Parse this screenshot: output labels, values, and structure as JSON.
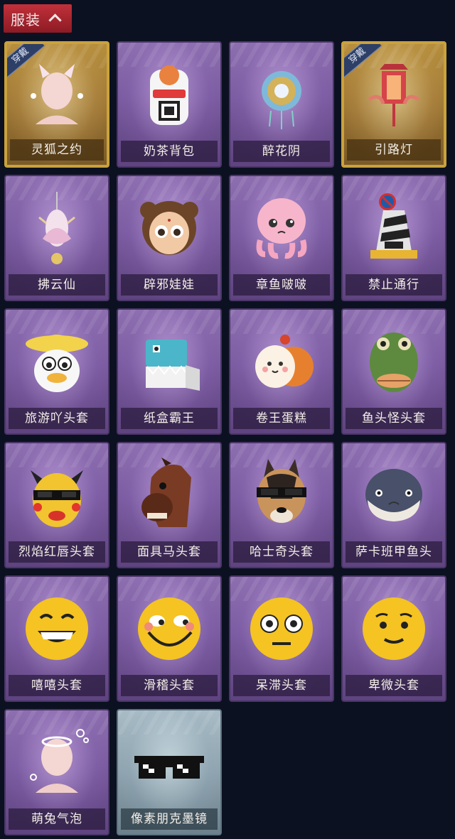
{
  "header": {
    "title": "服装"
  },
  "wear_label": "穿戴",
  "items": [
    {
      "label": "灵狐之约",
      "style": "gold",
      "worn": true,
      "icon": "fox-avatar-icon"
    },
    {
      "label": "奶茶背包",
      "style": "purple",
      "worn": false,
      "icon": "milk-tea-backpack-icon"
    },
    {
      "label": "醉花阴",
      "style": "purple",
      "worn": false,
      "icon": "flower-ornament-icon"
    },
    {
      "label": "引路灯",
      "style": "gold",
      "worn": true,
      "icon": "lantern-icon"
    },
    {
      "label": "拂云仙",
      "style": "purple",
      "worn": false,
      "icon": "cloud-fairy-charm-icon"
    },
    {
      "label": "辟邪娃娃",
      "style": "purple",
      "worn": false,
      "icon": "doll-head-icon"
    },
    {
      "label": "章鱼啵啵",
      "style": "purple",
      "worn": false,
      "icon": "octopus-icon"
    },
    {
      "label": "禁止通行",
      "style": "purple",
      "worn": false,
      "icon": "traffic-cone-icon"
    },
    {
      "label": "旅游吖头套",
      "style": "purple",
      "worn": false,
      "icon": "duck-hat-icon"
    },
    {
      "label": "纸盒霸王",
      "style": "purple",
      "worn": false,
      "icon": "box-dinosaur-icon"
    },
    {
      "label": "卷王蛋糕",
      "style": "purple",
      "worn": false,
      "icon": "roll-cake-icon"
    },
    {
      "label": "鱼头怪头套",
      "style": "purple",
      "worn": false,
      "icon": "fish-head-icon"
    },
    {
      "label": "烈焰红唇头套",
      "style": "purple",
      "worn": false,
      "icon": "yellow-mask-sunglasses-icon"
    },
    {
      "label": "面具马头套",
      "style": "purple",
      "worn": false,
      "icon": "horse-head-icon"
    },
    {
      "label": "哈士奇头套",
      "style": "purple",
      "worn": false,
      "icon": "husky-head-icon"
    },
    {
      "label": "萨卡班甲鱼头",
      "style": "purple",
      "worn": false,
      "icon": "round-fish-icon"
    },
    {
      "label": "嘻嘻头套",
      "style": "purple",
      "worn": false,
      "icon": "grin-emoji-icon"
    },
    {
      "label": "滑稽头套",
      "style": "purple",
      "worn": false,
      "icon": "funny-emoji-icon"
    },
    {
      "label": "呆滞头套",
      "style": "purple",
      "worn": false,
      "icon": "dazed-emoji-icon"
    },
    {
      "label": "卑微头套",
      "style": "purple",
      "worn": false,
      "icon": "humble-emoji-icon"
    },
    {
      "label": "萌兔气泡",
      "style": "purple",
      "worn": false,
      "icon": "bubble-avatar-icon"
    },
    {
      "label": "像素朋克墨镜",
      "style": "blue",
      "worn": false,
      "icon": "pixel-sunglasses-icon"
    }
  ]
}
